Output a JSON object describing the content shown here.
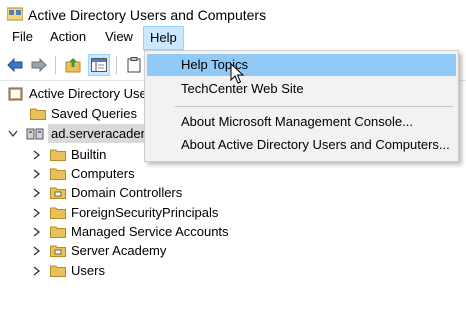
{
  "window": {
    "title": "Active Directory Users and Computers",
    "app_icon": "aduc-app-icon"
  },
  "menubar": {
    "items": [
      "File",
      "Action",
      "View",
      "Help"
    ],
    "active": "Help"
  },
  "toolbar": {
    "buttons": [
      "back-arrow-icon",
      "forward-arrow-icon",
      "up-folder-icon",
      "show-hide-console-tree-icon",
      "clipboard-icon"
    ]
  },
  "tree": {
    "root": "Active Directory Use",
    "saved_queries": "Saved Queries",
    "domain": "ad.serveracader",
    "children": [
      "Builtin",
      "Computers",
      "Domain Controllers",
      "ForeignSecurityPrincipals",
      "Managed Service Accounts",
      "Server Academy",
      "Users"
    ]
  },
  "help_menu": {
    "items": [
      "Help Topics",
      "TechCenter Web Site",
      "About Microsoft Management Console...",
      "About Active Directory Users and Computers..."
    ],
    "hovered": "Help Topics"
  },
  "colors": {
    "menu_active": "#cce8ff",
    "dropdown_hover": "#91c9f7",
    "folder": "#e8c15a",
    "selection": "#d9d9d9"
  }
}
